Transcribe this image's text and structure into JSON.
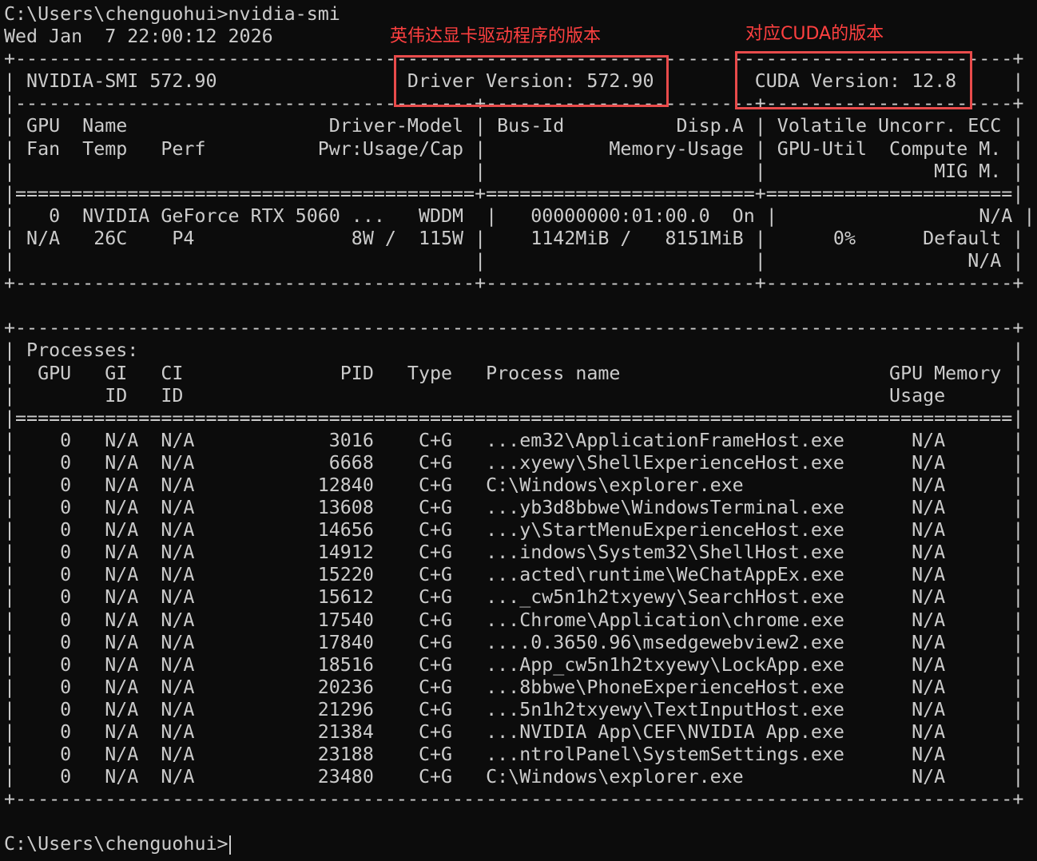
{
  "terminal": {
    "prompt_command": "C:\\Users\\chenguohui>nvidia-smi",
    "timestamp": "Wed Jan  7 22:00:12 2026",
    "rows": [
      "+-----------------------------------------------------------------------------------------+",
      "| NVIDIA-SMI 572.90                 Driver Version: 572.90         CUDA Version: 12.8     |",
      "|-----------------------------------------+------------------------+----------------------+",
      "| GPU  Name                  Driver-Model | Bus-Id          Disp.A | Volatile Uncorr. ECC |",
      "| Fan  Temp   Perf          Pwr:Usage/Cap |           Memory-Usage | GPU-Util  Compute M. |",
      "|                                         |                        |               MIG M. |",
      "|=========================================+========================+======================|",
      "|   0  NVIDIA GeForce RTX 5060 ...   WDDM  |   00000000:01:00.0  On |                  N/A |",
      "| N/A   26C    P4              8W /  115W |    1142MiB /   8151MiB |      0%      Default |",
      "|                                         |                        |                  N/A |",
      "+-----------------------------------------+------------------------+----------------------+",
      "",
      "+-----------------------------------------------------------------------------------------+",
      "| Processes:                                                                              |",
      "|  GPU   GI   CI              PID   Type   Process name                        GPU Memory |",
      "|        ID   ID                                                               Usage      |",
      "|=========================================================================================|",
      "|    0   N/A  N/A            3016    C+G   ...em32\\ApplicationFrameHost.exe      N/A      |",
      "|    0   N/A  N/A            6668    C+G   ...xyewy\\ShellExperienceHost.exe      N/A      |",
      "|    0   N/A  N/A           12840    C+G   C:\\Windows\\explorer.exe               N/A      |",
      "|    0   N/A  N/A           13608    C+G   ...yb3d8bbwe\\WindowsTerminal.exe      N/A      |",
      "|    0   N/A  N/A           14656    C+G   ...y\\StartMenuExperienceHost.exe      N/A      |",
      "|    0   N/A  N/A           14912    C+G   ...indows\\System32\\ShellHost.exe      N/A      |",
      "|    0   N/A  N/A           15220    C+G   ...acted\\runtime\\WeChatAppEx.exe      N/A      |",
      "|    0   N/A  N/A           15612    C+G   ..._cw5n1h2txyewy\\SearchHost.exe      N/A      |",
      "|    0   N/A  N/A           17540    C+G   ...Chrome\\Application\\chrome.exe      N/A      |",
      "|    0   N/A  N/A           17840    C+G   ....0.3650.96\\msedgewebview2.exe      N/A      |",
      "|    0   N/A  N/A           18516    C+G   ...App_cw5n1h2txyewy\\LockApp.exe      N/A      |",
      "|    0   N/A  N/A           20236    C+G   ...8bbwe\\PhoneExperienceHost.exe      N/A      |",
      "|    0   N/A  N/A           21296    C+G   ...5n1h2txyewy\\TextInputHost.exe      N/A      |",
      "|    0   N/A  N/A           21384    C+G   ...NVIDIA App\\CEF\\NVIDIA App.exe      N/A      |",
      "|    0   N/A  N/A           23188    C+G   ...ntrolPanel\\SystemSettings.exe      N/A      |",
      "|    0   N/A  N/A           23480    C+G   C:\\Windows\\explorer.exe               N/A      |",
      "+-----------------------------------------------------------------------------------------+",
      ""
    ],
    "final_prompt": "C:\\Users\\chenguohui>"
  },
  "annotations": {
    "driver_label": "英伟达显卡驱动程序的版本",
    "cuda_label": "对应CUDA的版本",
    "color": "#ff4040"
  }
}
